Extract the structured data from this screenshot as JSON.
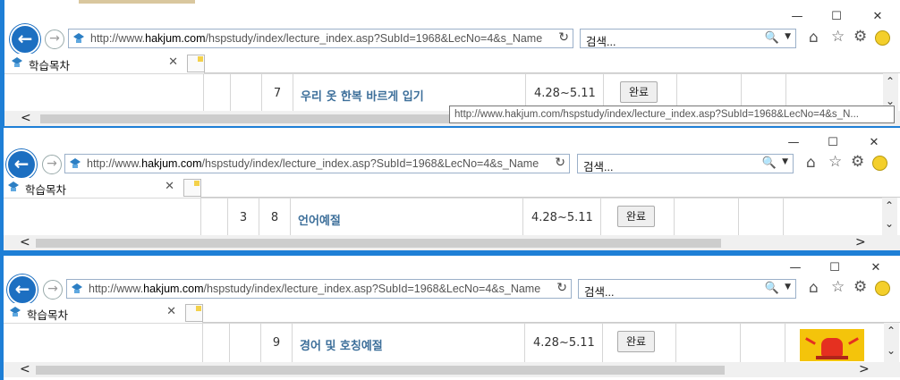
{
  "window_controls": {
    "minimize": "—",
    "maximize": "☐",
    "close": "✕"
  },
  "nav": {
    "back": "←",
    "forward": "→"
  },
  "address": {
    "prefix": "http://www.",
    "domain": "hakjum.com",
    "path": "/hspstudy/index/lecture_index.asp?SubId=1968&LecNo=4&s_Name",
    "refresh": "↻"
  },
  "search": {
    "placeholder": "검색...",
    "icon": "🔍",
    "dropdown": "▼"
  },
  "toolbar": {
    "home": "⌂",
    "favorites": "☆",
    "settings": "⚙"
  },
  "tab": {
    "label": "학습목차",
    "close": "✕"
  },
  "tooltip": "http://www.hakjum.com/hspstudy/index/lecture_index.asp?SubId=1968&LecNo=4&s_N...",
  "scroll": {
    "left": "<",
    "right": ">",
    "up": "⌃",
    "down": "⌄"
  },
  "windows": [
    {
      "index_cell": "",
      "row_number": "7",
      "title": "우리 옷 한복 바르게 입기",
      "period": "4.28~5.11",
      "status_button": "완료"
    },
    {
      "index_cell": "3",
      "row_number": "8",
      "title": "언어예절",
      "period": "4.28~5.11",
      "status_button": "완료"
    },
    {
      "index_cell": "",
      "row_number": "9",
      "title": "경어 및 호칭예절",
      "period": "4.28~5.11",
      "status_button": "완료"
    }
  ]
}
